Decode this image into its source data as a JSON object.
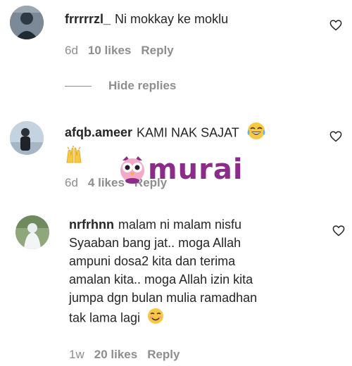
{
  "comments": [
    {
      "username": "frrrrrzl_",
      "text": "Ni mokkay ke moklu",
      "time": "6d",
      "likes": "10 likes",
      "reply": "Reply"
    },
    {
      "username": "afqb.ameer",
      "text": "KAMI NAK SAJAT",
      "time": "6d",
      "likes": "4 likes",
      "reply": "Reply"
    },
    {
      "username": "nrfrhnn",
      "text_lines": [
        "malam ni malam nisfu",
        "Syaaban bang jat.. moga Allah",
        "ampuni dosa2 kita dan terima",
        "amalan kita.. moga Allah izin kita",
        "jumpa dgn bulan mulia ramadhan",
        "tak lama lagi"
      ],
      "time": "1w",
      "likes": "20 likes",
      "reply": "Reply"
    }
  ],
  "hide_replies": "Hide replies",
  "watermark": "murai",
  "icons": {
    "heart": "heart-outline-icon",
    "laugh": "tears-of-joy-emoji-icon",
    "hands": "raising-hands-emoji-icon",
    "smile": "smiling-emoji-icon",
    "logo": "owl-logo-icon"
  },
  "colors": {
    "text": "#262626",
    "meta": "#8e8e8e",
    "watermark": "#8b2c8a"
  }
}
